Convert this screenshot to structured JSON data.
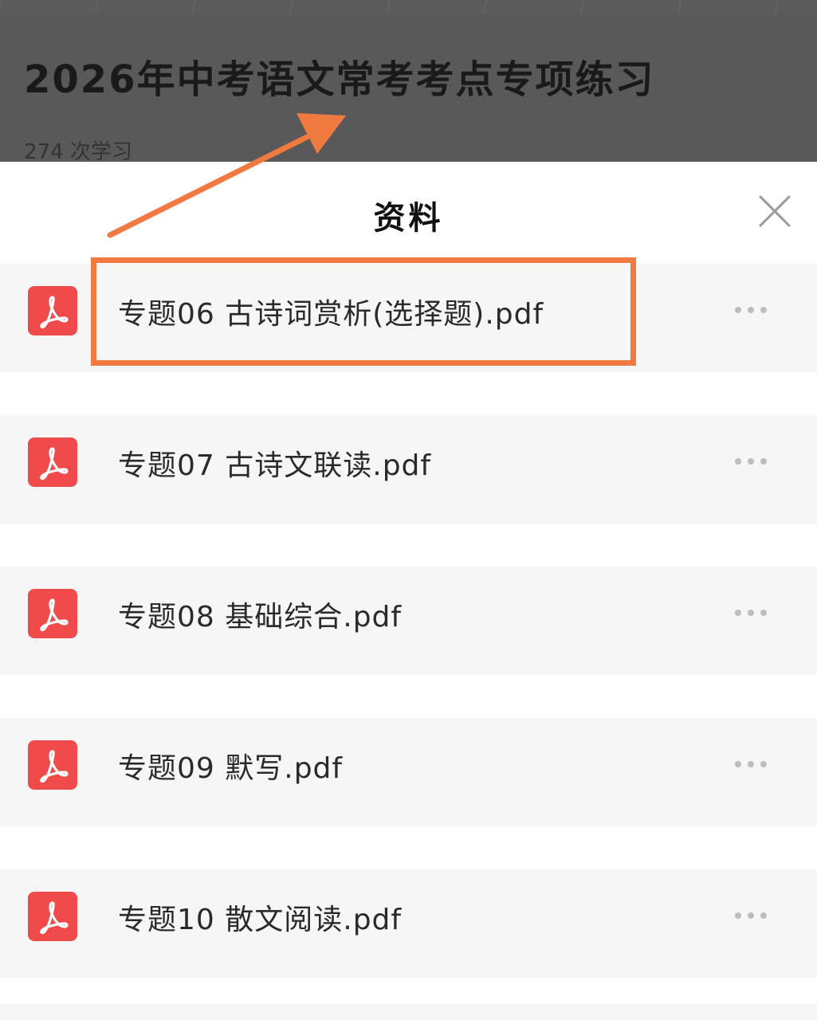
{
  "background_page": {
    "course_title": "2026年中考语文常考考点专项练习",
    "study_count": "274 次学习"
  },
  "sheet": {
    "title": "资料",
    "close_icon": "close-icon",
    "files": [
      {
        "name": "专题06 古诗词赏析(选择题).pdf",
        "icon": "pdf-icon",
        "highlighted": true
      },
      {
        "name": "专题07 古诗文联读.pdf",
        "icon": "pdf-icon",
        "highlighted": false
      },
      {
        "name": "专题08 基础综合.pdf",
        "icon": "pdf-icon",
        "highlighted": false
      },
      {
        "name": "专题09 默写.pdf",
        "icon": "pdf-icon",
        "highlighted": false
      },
      {
        "name": "专题10 散文阅读.pdf",
        "icon": "pdf-icon",
        "highlighted": false
      }
    ]
  },
  "colors": {
    "pdf_icon": "#f04a4a",
    "annotation": "#f07a3f",
    "backdrop": "#595959",
    "row_bg": "#f6f6f6"
  }
}
